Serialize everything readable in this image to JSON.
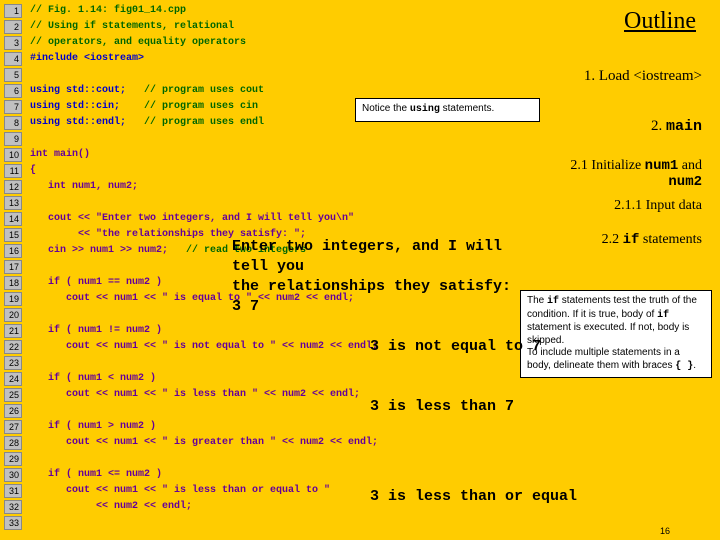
{
  "outline": "Outline",
  "lines": [
    {
      "n": "1",
      "code": "// Fig. 1.14: fig01_14.cpp",
      "cls": "green"
    },
    {
      "n": "2",
      "code": "// Using if statements, relational",
      "cls": "green"
    },
    {
      "n": "3",
      "code": "// operators, and equality operators",
      "cls": "green"
    },
    {
      "n": "4",
      "code": "#include <iostream>",
      "cls": "blue"
    },
    {
      "n": "5",
      "code": "",
      "cls": ""
    },
    {
      "n": "6",
      "code": "using std::cout;   // program uses cout",
      "cls": "blue",
      "cmtStart": 19
    },
    {
      "n": "7",
      "code": "using std::cin;    // program uses cin",
      "cls": "blue",
      "cmtStart": 19
    },
    {
      "n": "8",
      "code": "using std::endl;   // program uses endl",
      "cls": "blue",
      "cmtStart": 19
    },
    {
      "n": "9",
      "code": "",
      "cls": ""
    },
    {
      "n": "10",
      "code": "int main()",
      "cls": "purple"
    },
    {
      "n": "11",
      "code": "{",
      "cls": "purple"
    },
    {
      "n": "12",
      "code": "   int num1, num2;",
      "cls": "purple"
    },
    {
      "n": "13",
      "code": "",
      "cls": ""
    },
    {
      "n": "14",
      "code": "   cout << \"Enter two integers, and I will tell you\\n\"",
      "cls": "purple"
    },
    {
      "n": "15",
      "code": "        << \"the relationships they satisfy: \";",
      "cls": "purple"
    },
    {
      "n": "16",
      "code": "   cin >> num1 >> num2;   // read two integers",
      "cls": "purple",
      "cmtStart": 26
    },
    {
      "n": "17",
      "code": "",
      "cls": ""
    },
    {
      "n": "18",
      "code": "   if ( num1 == num2 )",
      "cls": "purple"
    },
    {
      "n": "19",
      "code": "      cout << num1 << \" is equal to \" << num2 << endl;",
      "cls": "purple"
    },
    {
      "n": "20",
      "code": "",
      "cls": ""
    },
    {
      "n": "21",
      "code": "   if ( num1 != num2 )",
      "cls": "purple"
    },
    {
      "n": "22",
      "code": "      cout << num1 << \" is not equal to \" << num2 << endl;",
      "cls": "purple"
    },
    {
      "n": "23",
      "code": "",
      "cls": ""
    },
    {
      "n": "24",
      "code": "   if ( num1 < num2 )",
      "cls": "purple"
    },
    {
      "n": "25",
      "code": "      cout << num1 << \" is less than \" << num2 << endl;",
      "cls": "purple"
    },
    {
      "n": "26",
      "code": "",
      "cls": ""
    },
    {
      "n": "27",
      "code": "   if ( num1 > num2 )",
      "cls": "purple"
    },
    {
      "n": "28",
      "code": "      cout << num1 << \" is greater than \" << num2 << endl;",
      "cls": "purple"
    },
    {
      "n": "29",
      "code": "",
      "cls": ""
    },
    {
      "n": "30",
      "code": "   if ( num1 <= num2 )",
      "cls": "purple"
    },
    {
      "n": "31",
      "code": "      cout << num1 << \" is less than or equal to \"",
      "cls": "purple"
    },
    {
      "n": "32",
      "code": "           << num2 << endl;",
      "cls": "purple"
    },
    {
      "n": "33",
      "code": "",
      "cls": ""
    }
  ],
  "annots": {
    "load": "1. Load <iostream>",
    "main": "2. main",
    "init": "2.1 Initialize num1 and\nnum2",
    "input": "2.1.1 Input data",
    "ifstmts": "2.2 if statements"
  },
  "callouts": {
    "using": "Notice the using statements.",
    "ifbody": "The if statements test the truth of the condition. If it is true, body of if statement is executed. If not, body is skipped.\nTo include multiple statements in a body, delineate them with braces { }."
  },
  "output": {
    "l1": "Enter two integers, and I will",
    "l2": "tell you",
    "l3": "the relationships they satisfy:",
    "l4": "3 7",
    "l5": "3 is not equal to 7",
    "l6": "3 is less than 7",
    "l7": "3 is less than or equal"
  },
  "pagenum": "16"
}
